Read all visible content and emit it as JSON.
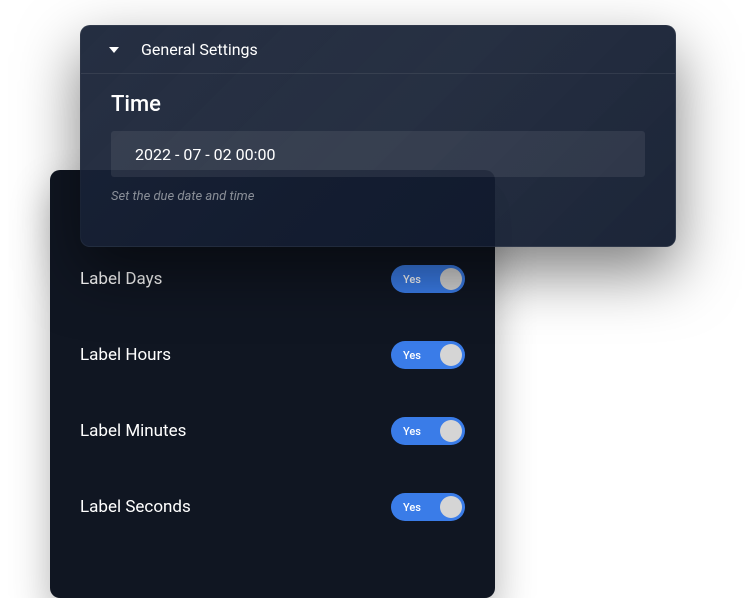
{
  "panel": {
    "title": "General Settings",
    "time_label": "Time",
    "time_value": "2022 - 07 - 02  00:00",
    "time_hint": "Set the due date and time"
  },
  "toggles": {
    "days": {
      "label": "Label Days",
      "state": "Yes"
    },
    "hours": {
      "label": "Label Hours",
      "state": "Yes"
    },
    "minutes": {
      "label": "Label Minutes",
      "state": "Yes"
    },
    "seconds": {
      "label": "Label Seconds",
      "state": "Yes"
    }
  },
  "colors": {
    "toggle_active": "#3a7ce8",
    "panel_bg": "#101622"
  }
}
